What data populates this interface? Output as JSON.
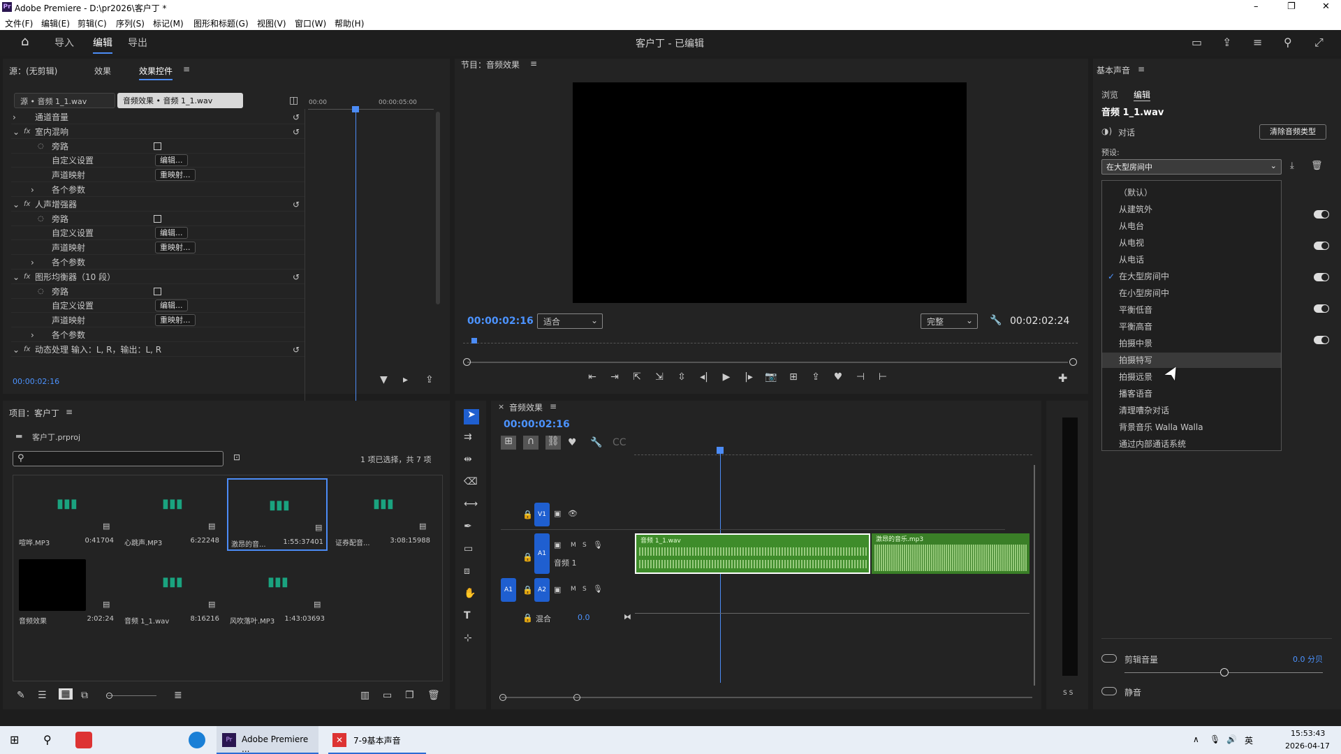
{
  "window": {
    "title": "Adobe Premiere - D:\\pr2026\\客户丁 *",
    "min": "–",
    "max": "❐",
    "close": "✕"
  },
  "menu": [
    "文件(F)",
    "编辑(E)",
    "剪辑(C)",
    "序列(S)",
    "标记(M)",
    "图形和标题(G)",
    "视图(V)",
    "窗口(W)",
    "帮助(H)"
  ],
  "workspace": {
    "tabs": [
      "导入",
      "编辑",
      "导出"
    ],
    "active": "编辑",
    "doc_title": "客户丁 - 已编辑"
  },
  "effects_panel": {
    "tabs": [
      "源：(无剪辑)",
      "效果",
      "效果控件"
    ],
    "source_chip": "源 • 音频 1_1.wav",
    "target_chip": "音频效果 • 音频 1_1.wav",
    "ruler": [
      "00:00",
      "00:00:05:00"
    ],
    "timecode": "00:00:02:16",
    "rows": [
      {
        "indent": 0,
        "arrow": "›",
        "fx": "",
        "label": "通道音量",
        "value": "",
        "reset": true
      },
      {
        "indent": 0,
        "arrow": "⌄",
        "fx": "fx",
        "label": "室内混响",
        "value": "",
        "reset": true
      },
      {
        "indent": 1,
        "arrow": "",
        "fx": "◌",
        "label": "旁路",
        "value": "checkbox",
        "reset": false
      },
      {
        "indent": 1,
        "arrow": "",
        "fx": "",
        "label": "自定义设置",
        "value": "编辑...",
        "reset": false
      },
      {
        "indent": 1,
        "arrow": "",
        "fx": "",
        "label": "声道映射",
        "value": "重映射...",
        "reset": false
      },
      {
        "indent": 1,
        "arrow": "›",
        "fx": "",
        "label": "各个参数",
        "value": "",
        "reset": false
      },
      {
        "indent": 0,
        "arrow": "⌄",
        "fx": "fx",
        "label": "人声增强器",
        "value": "",
        "reset": true
      },
      {
        "indent": 1,
        "arrow": "",
        "fx": "◌",
        "label": "旁路",
        "value": "checkbox",
        "reset": false
      },
      {
        "indent": 1,
        "arrow": "",
        "fx": "",
        "label": "自定义设置",
        "value": "编辑...",
        "reset": false
      },
      {
        "indent": 1,
        "arrow": "",
        "fx": "",
        "label": "声道映射",
        "value": "重映射...",
        "reset": false
      },
      {
        "indent": 1,
        "arrow": "›",
        "fx": "",
        "label": "各个参数",
        "value": "",
        "reset": false
      },
      {
        "indent": 0,
        "arrow": "⌄",
        "fx": "fx",
        "label": "图形均衡器（10 段）",
        "value": "",
        "reset": true
      },
      {
        "indent": 1,
        "arrow": "",
        "fx": "◌",
        "label": "旁路",
        "value": "checkbox",
        "reset": false
      },
      {
        "indent": 1,
        "arrow": "",
        "fx": "",
        "label": "自定义设置",
        "value": "编辑...",
        "reset": false
      },
      {
        "indent": 1,
        "arrow": "",
        "fx": "",
        "label": "声道映射",
        "value": "重映射...",
        "reset": false
      },
      {
        "indent": 1,
        "arrow": "›",
        "fx": "",
        "label": "各个参数",
        "value": "",
        "reset": false
      },
      {
        "indent": 0,
        "arrow": "⌄",
        "fx": "fx",
        "label": "动态处理  输入：L, R，输出：L, R",
        "value": "",
        "reset": true
      }
    ]
  },
  "program": {
    "title": "节目：音频效果",
    "timecode": "00:00:02:16",
    "fit": "适合",
    "quality": "完整",
    "duration": "00:02:02:24",
    "controls": [
      "⇤",
      "⇥",
      "⇱",
      "⇲",
      "⇳",
      "◂|",
      "▶",
      "|▸",
      "📷",
      "⊞",
      "⇪",
      "♥",
      "⊣",
      "⊢"
    ]
  },
  "project": {
    "title": "项目：客户丁",
    "file": "客户丁.prproj",
    "search_placeholder": "",
    "selection": "1 项已选择，共 7 项",
    "items": [
      {
        "name": "喧哗.MP3",
        "duration": "0:41704",
        "kind": "audio"
      },
      {
        "name": "心跳声.MP3",
        "duration": "6:22248",
        "kind": "audio"
      },
      {
        "name": "激昂的音...",
        "duration": "1:55:37401",
        "kind": "audio",
        "selected": true
      },
      {
        "name": "证券配音...",
        "duration": "3:08:15988",
        "kind": "audio"
      },
      {
        "name": "音频效果",
        "duration": "2:02:24",
        "kind": "sequence"
      },
      {
        "name": "音频 1_1.wav",
        "duration": "8:16216",
        "kind": "audio"
      },
      {
        "name": "风吹落叶.MP3",
        "duration": "1:43:03693",
        "kind": "audio"
      }
    ]
  },
  "timeline": {
    "title": "音频效果",
    "timecode": "00:00:02:16",
    "tracks": {
      "v1": "V1",
      "a1": "A1",
      "a1_name": "音频 1",
      "a2": "A2",
      "src_a1": "A1",
      "mix": "混合",
      "mix_value": "0.0"
    },
    "clips": [
      {
        "label": "音频 1_1.wav"
      },
      {
        "label": "激昂的音乐.mp3"
      }
    ]
  },
  "essential_sound": {
    "title": "基本声音",
    "tabs": [
      "浏览",
      "编辑"
    ],
    "clip": "音频 1_1.wav",
    "type": "对话",
    "clear_button": "清除音频类型",
    "preset_label": "预设:",
    "preset_value": "在大型房间中",
    "options": [
      "（默认）",
      "从建筑外",
      "从电台",
      "从电视",
      "从电话",
      "在大型房间中",
      "在小型房间中",
      "平衡低音",
      "平衡高音",
      "拍摄中景",
      "拍摄特写",
      "拍摄远景",
      "播客语音",
      "清理嘈杂对话",
      "背景音乐 Walla Walla",
      "通过内部通话系统"
    ],
    "checked": "在大型房间中",
    "hovered": "拍摄特写",
    "clip_volume": "剪辑音量",
    "clip_volume_value": "0.0 分贝",
    "mute": "静音"
  },
  "taskbar": {
    "apps": [
      "Adobe Premiere ...",
      "7-9基本声音"
    ],
    "ime": "英",
    "time": "15:53:43",
    "date": "2026-04-17"
  },
  "meter": {
    "labels": "S S"
  }
}
